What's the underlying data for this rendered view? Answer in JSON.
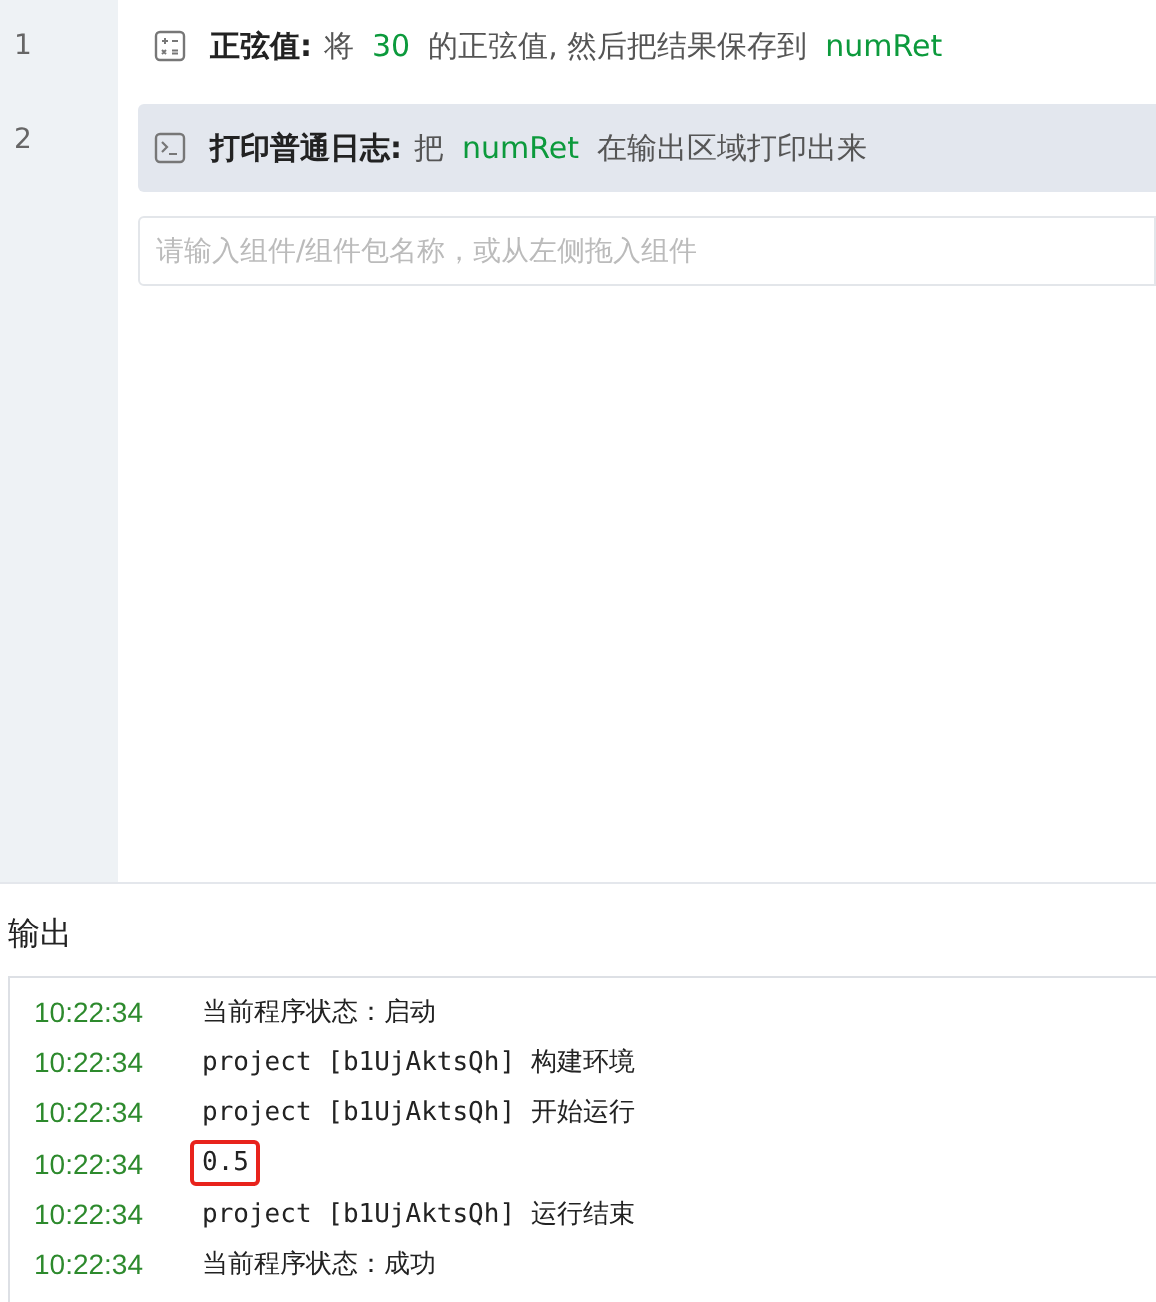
{
  "editor": {
    "statements": [
      {
        "line": "1",
        "kind": "calculator",
        "selected": false,
        "label": "正弦值:",
        "parts": [
          {
            "kind": "text",
            "text": "将"
          },
          {
            "kind": "var",
            "text": "30"
          },
          {
            "kind": "text",
            "text": "的正弦值, 然后把结果保存到"
          },
          {
            "kind": "var",
            "text": "numRet"
          }
        ]
      },
      {
        "line": "2",
        "kind": "terminal",
        "selected": true,
        "label": "打印普通日志:",
        "parts": [
          {
            "kind": "text",
            "text": "把"
          },
          {
            "kind": "var",
            "text": "numRet"
          },
          {
            "kind": "text",
            "text": "在输出区域打印出来"
          }
        ]
      }
    ],
    "search": {
      "placeholder": "请输入组件/组件包名称，或从左侧拖入组件"
    }
  },
  "output": {
    "title": "输出",
    "logs": [
      {
        "time": "10:22:34",
        "message": "当前程序状态：启动",
        "highlighted": false
      },
      {
        "time": "10:22:34",
        "message": "project [b1UjAktsQh] 构建环境",
        "highlighted": false
      },
      {
        "time": "10:22:34",
        "message": "project [b1UjAktsQh] 开始运行",
        "highlighted": false
      },
      {
        "time": "10:22:34",
        "message": "0.5",
        "highlighted": true
      },
      {
        "time": "10:22:34",
        "message": "project [b1UjAktsQh] 运行结束",
        "highlighted": false
      },
      {
        "time": "10:22:34",
        "message": "当前程序状态：成功",
        "highlighted": false
      }
    ]
  }
}
